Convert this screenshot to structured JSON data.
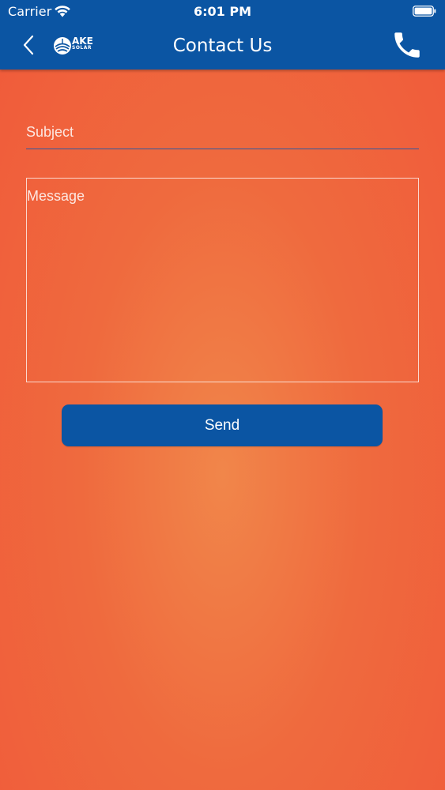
{
  "status_bar": {
    "carrier": "Carrier",
    "time": "6:01 PM"
  },
  "header": {
    "title": "Contact Us",
    "logo_main": "AKE",
    "logo_sub": "SOLAR"
  },
  "form": {
    "subject_placeholder": "Subject",
    "message_placeholder": "Message",
    "send_label": "Send"
  },
  "colors": {
    "header_blue": "#0b55a3",
    "background_orange": "#f05a3a",
    "button_blue": "#0b55a3"
  },
  "icons": {
    "back": "chevron-left-icon",
    "call": "phone-icon",
    "wifi": "wifi-icon",
    "battery": "battery-icon"
  }
}
